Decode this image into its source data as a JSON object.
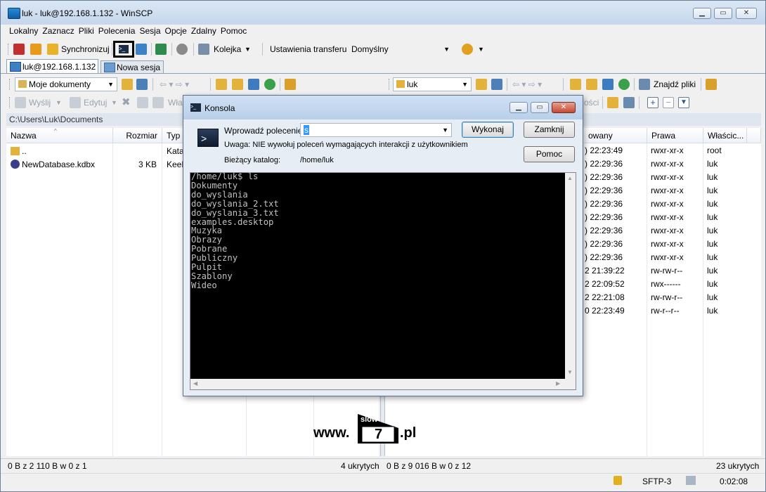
{
  "window": {
    "title": "luk - luk@192.168.1.132 - WinSCP"
  },
  "menu": [
    "Lokalny",
    "Zaznacz",
    "Pliki",
    "Polecenia",
    "Sesja",
    "Opcje",
    "Zdalny",
    "Pomoc"
  ],
  "toolbar": {
    "sync_label": "Synchronizuj",
    "queue_label": "Kolejka",
    "transfer_label": "Ustawienia transferu",
    "transfer_value": "Domyślny"
  },
  "tabs": {
    "session": "luk@192.168.1.132",
    "new_session": "Nowa sesja"
  },
  "local": {
    "path_combo": "Moje dokumenty",
    "path": "C:\\Users\\Luk\\Documents",
    "send": "Wyślij",
    "edit": "Edytuj",
    "props": "Właś",
    "columns": [
      "Nazwa",
      "Rozmiar",
      "Typ"
    ],
    "rows": [
      {
        "name": "..",
        "size": "",
        "type": "Kata"
      },
      {
        "name": "NewDatabase.kdbx",
        "size": "3 KB",
        "type": "KeeP"
      }
    ]
  },
  "remote": {
    "path_combo": "luk",
    "find_label": "Znajdź pliki",
    "props_tail": "ości",
    "columns": [
      "owany",
      "Prawa",
      "Właścic..."
    ],
    "rows": [
      {
        "changed": ") 22:23:49",
        "rights": "rwxr-xr-x",
        "owner": "root"
      },
      {
        "changed": ") 22:29:36",
        "rights": "rwxr-xr-x",
        "owner": "luk"
      },
      {
        "changed": ") 22:29:36",
        "rights": "rwxr-xr-x",
        "owner": "luk"
      },
      {
        "changed": ") 22:29:36",
        "rights": "rwxr-xr-x",
        "owner": "luk"
      },
      {
        "changed": ") 22:29:36",
        "rights": "rwxr-xr-x",
        "owner": "luk"
      },
      {
        "changed": ") 22:29:36",
        "rights": "rwxr-xr-x",
        "owner": "luk"
      },
      {
        "changed": ") 22:29:36",
        "rights": "rwxr-xr-x",
        "owner": "luk"
      },
      {
        "changed": ") 22:29:36",
        "rights": "rwxr-xr-x",
        "owner": "luk"
      },
      {
        "changed": ") 22:29:36",
        "rights": "rwxr-xr-x",
        "owner": "luk"
      },
      {
        "changed": "2 21:39:22",
        "rights": "rw-rw-r--",
        "owner": "luk"
      },
      {
        "changed": "2 22:09:52",
        "rights": "rwx------",
        "owner": "luk"
      },
      {
        "changed": "2 22:21:08",
        "rights": "rw-rw-r--",
        "owner": "luk"
      },
      {
        "changed": "0 22:23:49",
        "rights": "rw-r--r--",
        "owner": "luk"
      }
    ]
  },
  "console": {
    "title": "Konsola",
    "command_label": "Wprowadź polecenie",
    "command_value": "s",
    "warning": "Uwaga: NIE wywołuj poleceń wymagających interakcji z użytkownikiem",
    "dir_label": "Bieżący katalog:",
    "dir_value": "/home/luk",
    "execute": "Wykonaj",
    "close": "Zamknij",
    "help": "Pomoc",
    "output": [
      "/home/luk$ ls",
      "Dokumenty",
      "do_wyslania",
      "do_wyslania_2.txt",
      "do_wyslania_3.txt",
      "examples.desktop",
      "Muzyka",
      "Obrazy",
      "Pobrane",
      "Publiczny",
      "Pulpit",
      "Szablony",
      "Wideo"
    ]
  },
  "watermark": {
    "pre": "www.",
    "badge_top": "slow",
    "badge_num": "7",
    "post": ".pl"
  },
  "status": {
    "local": "0 B z 2 110 B w 0 z 1",
    "hidden_local": "4 ukrytych",
    "remote": "0 B z 9 016 B w 0 z 12",
    "hidden_remote": "23 ukrytych",
    "protocol": "SFTP-3",
    "time": "0:02:08"
  }
}
